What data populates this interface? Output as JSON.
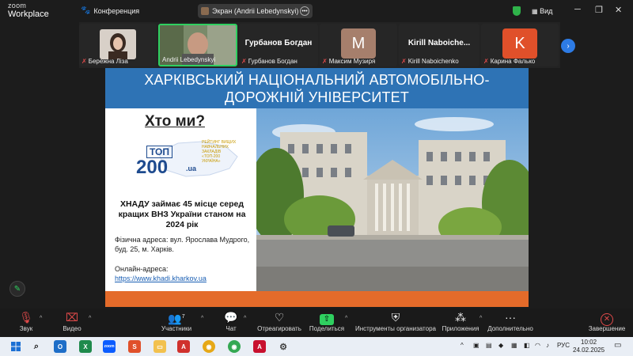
{
  "app": {
    "logo_line1": "zoom",
    "logo_line2": "Workplace",
    "meeting_label": "Конференция",
    "screen_label": "Экран (Andrii Lebedynskyi)",
    "view_label": "Вид"
  },
  "participants": [
    {
      "name": "Бережна Ліза",
      "type": "video"
    },
    {
      "name": "Andrii Lebedynskyi",
      "type": "video",
      "active": true
    },
    {
      "name": "Гурбанов Богдан",
      "type": "name"
    },
    {
      "name": "Максим Музиря",
      "letter": "M",
      "color": "#a67f6c"
    },
    {
      "name": "Kirill Naboichenko",
      "display": "Kirill  Naboiche...",
      "type": "name"
    },
    {
      "name": "Карина Фалько",
      "letter": "K",
      "color": "#e0502a"
    }
  ],
  "slide": {
    "header": "ХАРКІВСЬКИЙ НАЦІОНАЛЬНИЙ АВТОМОБІЛЬНО-ДОРОЖНІЙ УНІВЕРСИТЕТ",
    "who_title": "Хто ми?",
    "badge_top": "ТОП",
    "badge_200": "200",
    "badge_ua": ".ua",
    "badge_note": "РЕЙТИНГ ВИЩИХ НАВЧАЛЬНИХ ЗАКЛАДІВ «ТОП-200 УКРАЇНА»",
    "rank_text": "ХНАДУ займає 45 місце серед кращих ВНЗ України станом на 2024 рік",
    "address_label": "Фізична адреса",
    "address_text": ": вул. Ярослава Мудрого, буд. 25, м. Харків.",
    "online_label": "Онлайн-адреса:",
    "online_url": "https://www.khadi.kharkov.ua"
  },
  "toolbar": {
    "audio": "Звук",
    "video": "Видео",
    "participants": "Участники",
    "participants_count": "7",
    "chat": "Чат",
    "react": "Отреагировать",
    "share": "Поделиться",
    "host_tools": "Инструменты организатора",
    "apps": "Приложения",
    "more": "Дополнительно",
    "end": "Завершение"
  },
  "taskbar": {
    "lang": "РУС",
    "time": "10:02",
    "date": "24.02.2025"
  },
  "colors": {
    "slide_header": "#2e73b5",
    "slide_footer": "#e46b2a",
    "active_border": "#2fd060",
    "share_green": "#2fd060",
    "end_red": "#e04a4a"
  }
}
